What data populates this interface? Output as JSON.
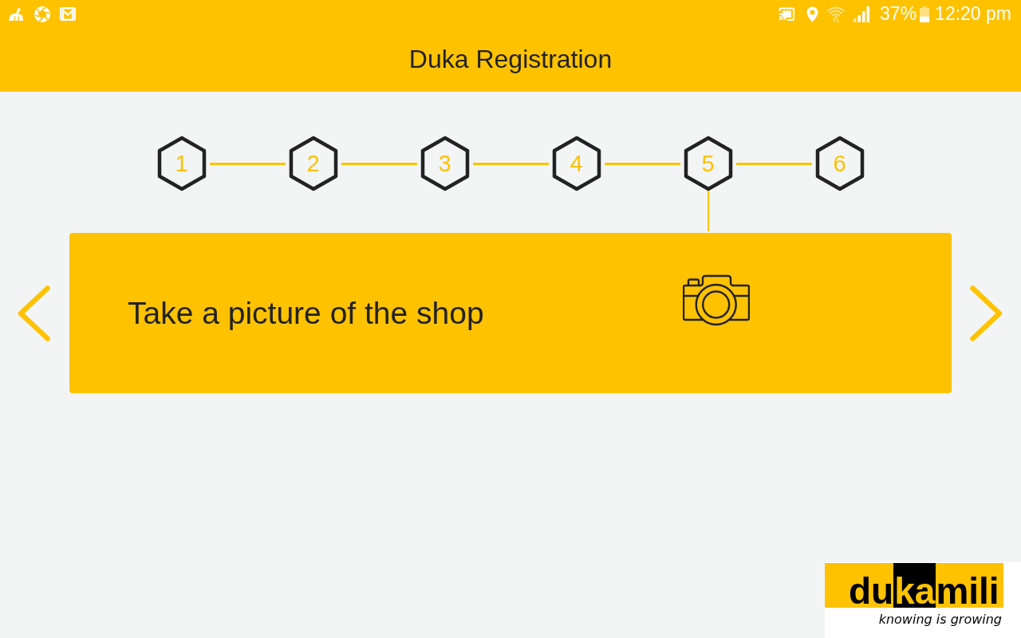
{
  "status_bar": {
    "battery": "37%",
    "time": "12:20 pm"
  },
  "app_bar": {
    "title": "Duka Registration"
  },
  "steps": [
    {
      "label": "1",
      "selected": false
    },
    {
      "label": "2",
      "selected": false
    },
    {
      "label": "3",
      "selected": false
    },
    {
      "label": "4",
      "selected": false
    },
    {
      "label": "5",
      "selected": true
    },
    {
      "label": "6",
      "selected": false
    }
  ],
  "card": {
    "prompt": "Take a picture of the shop"
  },
  "logo": {
    "wordmark": [
      {
        "text": "du",
        "highlighted": false
      },
      {
        "text": "ka",
        "highlighted": true
      },
      {
        "text": "mili",
        "highlighted": false
      }
    ],
    "tagline": "knowing is growing"
  }
}
